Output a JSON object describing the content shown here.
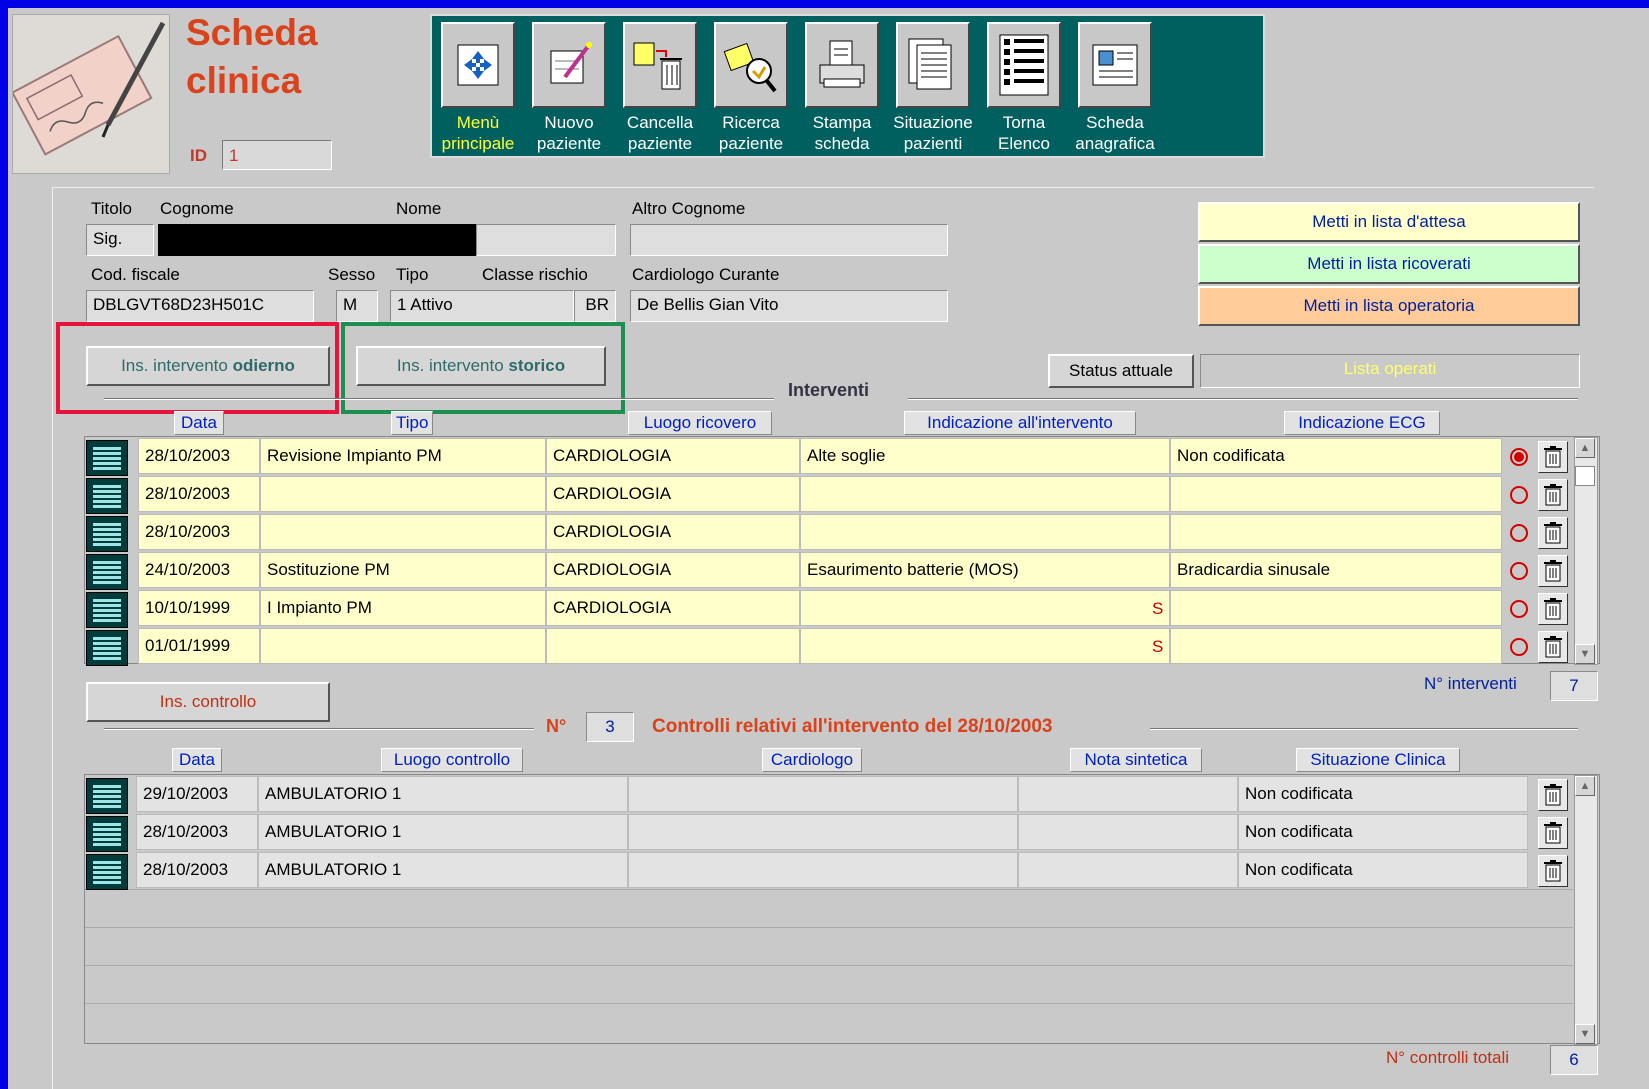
{
  "header": {
    "title_line1": "Scheda",
    "title_line2": "clinica",
    "id_label": "ID",
    "id_value": "1"
  },
  "toolbar": [
    {
      "line1": "Menù",
      "line2": "principale",
      "icon": "menu-icon"
    },
    {
      "line1": "Nuovo",
      "line2": "paziente",
      "icon": "new-patient-icon"
    },
    {
      "line1": "Cancella",
      "line2": "paziente",
      "icon": "delete-patient-icon"
    },
    {
      "line1": "Ricerca",
      "line2": "paziente",
      "icon": "search-patient-icon"
    },
    {
      "line1": "Stampa",
      "line2": "scheda",
      "icon": "print-icon"
    },
    {
      "line1": "Situazione",
      "line2": "pazienti",
      "icon": "patients-status-icon"
    },
    {
      "line1": "Torna",
      "line2": "Elenco",
      "icon": "back-list-icon"
    },
    {
      "line1": "Scheda",
      "line2": "anagrafica",
      "icon": "registry-card-icon"
    }
  ],
  "patient": {
    "labels": {
      "titolo": "Titolo",
      "cognome": "Cognome",
      "nome": "Nome",
      "altro_cognome": "Altro Cognome",
      "cod_fiscale": "Cod. fiscale",
      "sesso": "Sesso",
      "tipo": "Tipo",
      "classe_rischio": "Classe rischio",
      "cardiologo": "Cardiologo Curante"
    },
    "titolo": "Sig.",
    "cod_fiscale": "DBLGVT68D23H501C",
    "sesso": "M",
    "tipo": "1 Attivo",
    "classe_rischio": "BR",
    "cardiologo": "De Bellis  Gian Vito"
  },
  "list_buttons": {
    "attesa": "Metti in lista d'attesa",
    "ricoverati": "Metti in lista ricoverati",
    "operatoria": "Metti in lista operatoria"
  },
  "actions": {
    "ins_odierno_prefix": "Ins. intervento ",
    "ins_odierno_bold": "odierno",
    "ins_storico_prefix": "Ins. intervento ",
    "ins_storico_bold": "storico",
    "status_label": "Status attuale",
    "status_value": "Lista operati"
  },
  "interventi": {
    "section_title": "Interventi",
    "columns": [
      "Data",
      "Tipo",
      "Luogo ricovero",
      "Indicazione all'intervento",
      "Indicazione ECG"
    ],
    "rows": [
      {
        "data": "28/10/2003",
        "tipo": "Revisione Impianto  PM",
        "luogo": "CARDIOLOGIA",
        "indicazione": "Alte soglie",
        "flag": "",
        "ecg": "Non codificata",
        "selected": true
      },
      {
        "data": "28/10/2003",
        "tipo": "",
        "luogo": "CARDIOLOGIA",
        "indicazione": "",
        "flag": "",
        "ecg": "",
        "selected": false
      },
      {
        "data": "28/10/2003",
        "tipo": "",
        "luogo": "CARDIOLOGIA",
        "indicazione": "",
        "flag": "",
        "ecg": "",
        "selected": false
      },
      {
        "data": "24/10/2003",
        "tipo": "Sostituzione  PM",
        "luogo": "CARDIOLOGIA",
        "indicazione": "Esaurimento batterie (MOS)",
        "flag": "",
        "ecg": "Bradicardia sinusale",
        "selected": false
      },
      {
        "data": "10/10/1999",
        "tipo": "I Impianto  PM",
        "luogo": "CARDIOLOGIA",
        "indicazione": "",
        "flag": "S",
        "ecg": "",
        "selected": false
      },
      {
        "data": "01/01/1999",
        "tipo": "",
        "luogo": "",
        "indicazione": "",
        "flag": "S",
        "ecg": "",
        "selected": false
      }
    ],
    "count_label": "N° interventi",
    "count_value": "7"
  },
  "controlli": {
    "ins_label": "Ins. controllo",
    "n_label": "N°",
    "n_value": "3",
    "section_title": "Controlli relativi all'intervento del 28/10/2003",
    "columns": [
      "Data",
      "Luogo controllo",
      "Cardiologo",
      "Nota sintetica",
      "Situazione Clinica"
    ],
    "rows": [
      {
        "data": "29/10/2003",
        "luogo": "AMBULATORIO 1",
        "cardiologo": "",
        "nota": "",
        "situazione": "Non codificata"
      },
      {
        "data": "28/10/2003",
        "luogo": "AMBULATORIO 1",
        "cardiologo": "",
        "nota": "",
        "situazione": "Non codificata"
      },
      {
        "data": "28/10/2003",
        "luogo": "AMBULATORIO 1",
        "cardiologo": "",
        "nota": "",
        "situazione": "Non codificata"
      }
    ],
    "total_label": "N° controlli totali",
    "total_value": "6"
  },
  "colors": {
    "background": "#0000e6",
    "accent": "#d9421a",
    "toolbar": "#006060",
    "highlight_red": "#e8133a",
    "highlight_green": "#1f8f4f"
  }
}
